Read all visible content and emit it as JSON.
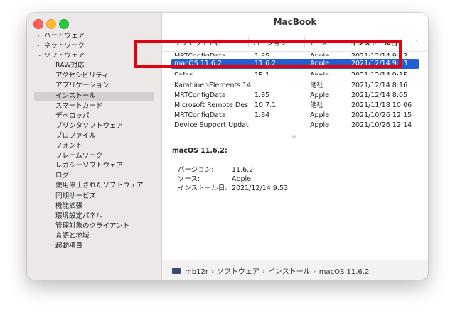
{
  "window": {
    "title": "MacBook"
  },
  "sidebar": {
    "items": [
      {
        "label": "ハードウェア",
        "level": "top",
        "expanded": false
      },
      {
        "label": "ネットワーク",
        "level": "top",
        "expanded": false
      },
      {
        "label": "ソフトウェア",
        "level": "top",
        "expanded": true
      },
      {
        "label": "RAW対応",
        "level": "sub"
      },
      {
        "label": "アクセシビリティ",
        "level": "sub"
      },
      {
        "label": "アプリケーション",
        "level": "sub"
      },
      {
        "label": "インストール",
        "level": "sub",
        "selected": true
      },
      {
        "label": "スマートカード",
        "level": "sub"
      },
      {
        "label": "デベロッパ",
        "level": "sub"
      },
      {
        "label": "プリンタソフトウェア",
        "level": "sub"
      },
      {
        "label": "プロファイル",
        "level": "sub"
      },
      {
        "label": "フォント",
        "level": "sub"
      },
      {
        "label": "フレームワーク",
        "level": "sub"
      },
      {
        "label": "レガシーソフトウェア",
        "level": "sub"
      },
      {
        "label": "ログ",
        "level": "sub"
      },
      {
        "label": "使用停止されたソフトウェア",
        "level": "sub"
      },
      {
        "label": "同期サービス",
        "level": "sub"
      },
      {
        "label": "機能拡張",
        "level": "sub"
      },
      {
        "label": "環境設定パネル",
        "level": "sub"
      },
      {
        "label": "管理対象のクライアント",
        "level": "sub"
      },
      {
        "label": "言語と地域",
        "level": "sub"
      },
      {
        "label": "起動項目",
        "level": "sub"
      }
    ]
  },
  "table": {
    "headers": [
      "ソフトウェア名",
      "バージョン",
      "ソース",
      "インストール日"
    ],
    "sorted_column": "インストール日",
    "rows": [
      {
        "cells": [
          "MRTConfigData",
          "1.85",
          "Apple",
          "2021/12/14 9:53"
        ],
        "partial": true
      },
      {
        "cells": [
          "macOS 11.6.2",
          "11.6.2",
          "Apple",
          "2021/12/14 9:53"
        ],
        "selected": true
      },
      {
        "cells": [
          "Safari",
          "15.1",
          "Apple",
          "2021/12/14 9:15"
        ],
        "partial": true
      },
      {
        "cells": [
          "Karabiner-Elements 14",
          "",
          "他社",
          "2021/12/14 8:16"
        ]
      },
      {
        "cells": [
          "MRTConfigData",
          "1.85",
          "Apple",
          "2021/12/14 8:05"
        ]
      },
      {
        "cells": [
          "Microsoft Remote Des",
          "10.7.1",
          "他社",
          "2021/11/18 10:06"
        ]
      },
      {
        "cells": [
          "MRTConfigData",
          "1.84",
          "Apple",
          "2021/10/26 12:15"
        ]
      },
      {
        "cells": [
          "Device Support Updat",
          "",
          "Apple",
          "2021/10/26 12:14"
        ]
      }
    ]
  },
  "detail": {
    "title": "macOS 11.6.2:",
    "fields": [
      {
        "label": "バージョン:",
        "value": "11.6.2"
      },
      {
        "label": "ソース:",
        "value": "Apple"
      },
      {
        "label": "インストール日:",
        "value": "2021/12/14 9:53"
      }
    ]
  },
  "breadcrumb": [
    "mb12r",
    "ソフトウェア",
    "インストール",
    "macOS 11.6.2"
  ],
  "colors": {
    "selection": "#1f5fcf",
    "highlight_box": "#e3000f"
  }
}
